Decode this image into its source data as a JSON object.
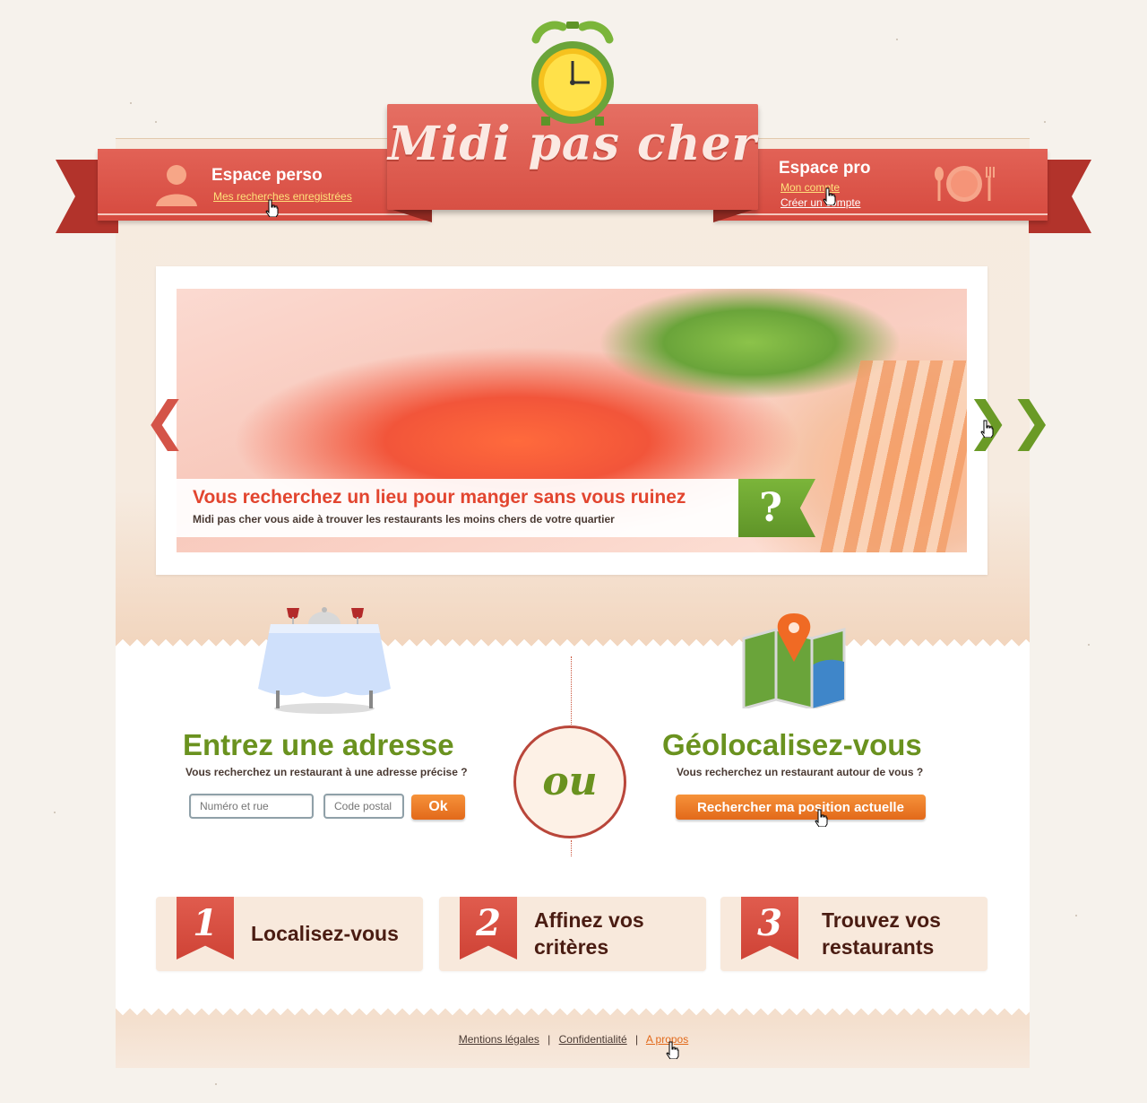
{
  "site": {
    "logo_text": "Midi pas cher"
  },
  "header": {
    "perso": {
      "title": "Espace perso",
      "link": "Mes recherches enregistrées"
    },
    "pro": {
      "title": "Espace pro",
      "link_account": "Mon compte",
      "link_create": "Créer un compte"
    }
  },
  "slider": {
    "prev_label": "❮",
    "next_label": "❯❯",
    "caption_title": "Vous recherchez un lieu pour manger sans vous ruinez",
    "caption_sub": "Midi pas cher vous aide à trouver les restaurants les moins chers de votre quartier",
    "badge": "?"
  },
  "search": {
    "address": {
      "title": "Entrez une adresse",
      "subtitle": "Vous recherchez un restaurant à une adresse précise ?",
      "street_placeholder": "Numéro et rue",
      "postal_placeholder": "Code postal",
      "ok_label": "Ok"
    },
    "or_label": "ou",
    "geo": {
      "title": "Géolocalisez-vous",
      "subtitle": "Vous recherchez un restaurant autour de vous ?",
      "button_label": "Rechercher ma position actuelle"
    }
  },
  "steps": [
    {
      "number": "1",
      "line1": "Localisez-vous",
      "line2": ""
    },
    {
      "number": "2",
      "line1": "Affinez vos",
      "line2": "critères"
    },
    {
      "number": "3",
      "line1": "Trouvez vos",
      "line2": "restaurants"
    }
  ],
  "footer": {
    "links": [
      "Mentions légales",
      "Confidentialité",
      "A propos"
    ],
    "separator": "|"
  },
  "colors": {
    "brand_red": "#d64a3f",
    "brand_green": "#6a921f",
    "button_orange": "#e2691a"
  }
}
